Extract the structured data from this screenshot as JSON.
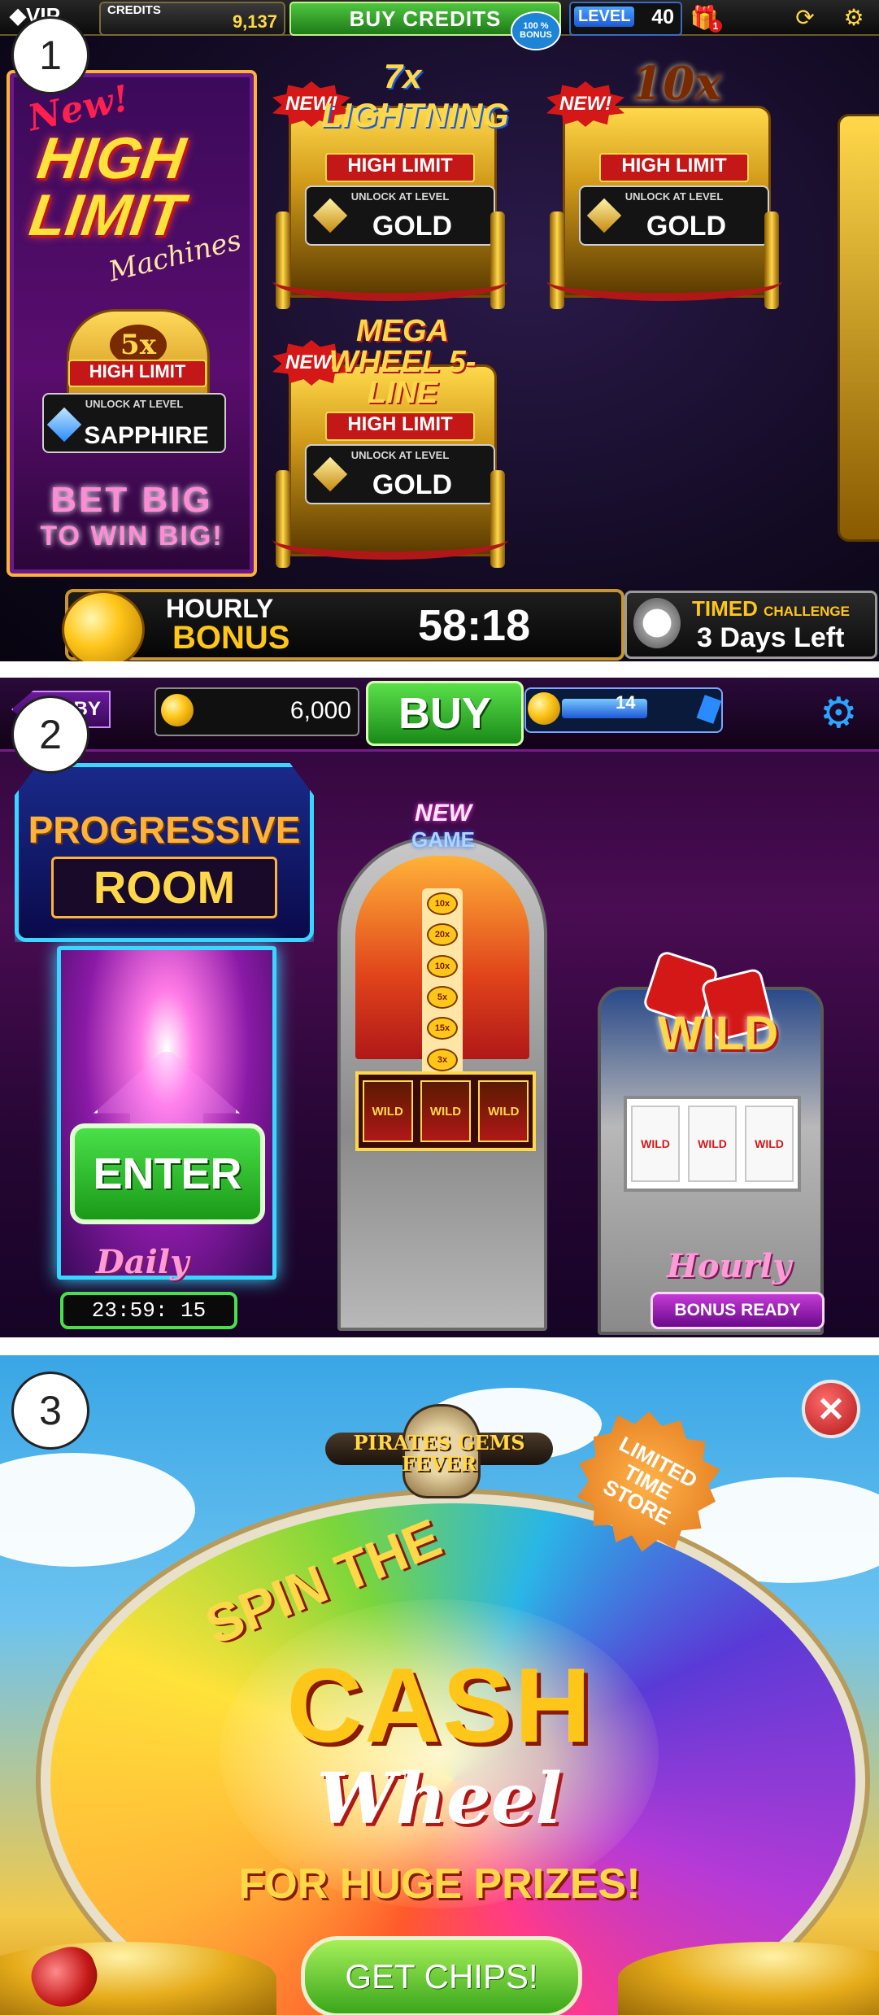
{
  "panel_numbers": [
    "1",
    "2",
    "3"
  ],
  "panel1": {
    "topbar": {
      "vip_label": "VIP",
      "credits_label": "CREDITS",
      "credits_value": "9,137",
      "buy_label": "BUY CREDITS",
      "bonus_seal": "100 % BONUS",
      "level_label": "LEVEL",
      "level_value": "40",
      "gift_count": "1",
      "icons": [
        "gift-icon",
        "coin-exchange-icon",
        "gear-icon"
      ]
    },
    "promo": {
      "new_label": "New!",
      "title": "HIGH LIMIT",
      "subtitle": "Machines",
      "multiplier": "5x",
      "high_limit": "HIGH LIMIT",
      "unlock_label": "UNLOCK AT LEVEL",
      "unlock_level": "SAPPHIRE",
      "bet_big": "BET BIG",
      "to_win_big": "TO WIN BIG!"
    },
    "machines": [
      {
        "new_label": "NEW!",
        "logo": "7x LIGHTNING",
        "high_limit": "HIGH LIMIT",
        "unlock_label": "UNLOCK AT LEVEL",
        "unlock_level": "GOLD"
      },
      {
        "new_label": "NEW!",
        "logo": "10x",
        "high_limit": "HIGH LIMIT",
        "unlock_label": "UNLOCK AT LEVEL",
        "unlock_level": "GOLD"
      },
      {
        "new_label": "NEW!",
        "logo": "MEGA WHEEL 5-LINE",
        "high_limit": "HIGH LIMIT",
        "unlock_label": "UNLOCK AT LEVEL",
        "unlock_level": "GOLD"
      }
    ],
    "hourly": {
      "line1": "HOURLY",
      "line2": "BONUS",
      "timer": "58:18"
    },
    "timed": {
      "label": "TIMED",
      "label_small": "CHALLENGE",
      "days_left": "3 Days Left"
    }
  },
  "panel2": {
    "topbar": {
      "lobby_label": "BY",
      "coins_value": "6,000",
      "buy_label": "BUY",
      "xp_level": "14",
      "xp_progress": 0.7
    },
    "progressive": {
      "line1": "PROGRESSIVE",
      "line2": "ROOM",
      "enter_label": "ENTER"
    },
    "daily": {
      "label": "Daily",
      "timer": "23:59: 15"
    },
    "new_game": {
      "line1": "NEW",
      "line2": "GAME"
    },
    "big_slot": {
      "chips": [
        "10x",
        "20x",
        "10x",
        "5x",
        "15x",
        "3x"
      ],
      "reels": [
        "WILD",
        "WILD",
        "WILD"
      ]
    },
    "wild_slot": {
      "logo": "WILD",
      "reels": [
        "WILD",
        "WILD",
        "WILD"
      ]
    },
    "hourly": {
      "label": "Hourly",
      "status": "BONUS READY"
    }
  },
  "panel3": {
    "close_icon": "close-icon",
    "pirates": "PIRATES GEMS FEVER",
    "limited": "LIMITED TIME STORE",
    "spin_the": "SPIN THE",
    "cash": "CASH",
    "wheel": "Wheel",
    "huge_prizes": "FOR HUGE PRIZES!",
    "get_chips": "GET CHIPS!"
  }
}
